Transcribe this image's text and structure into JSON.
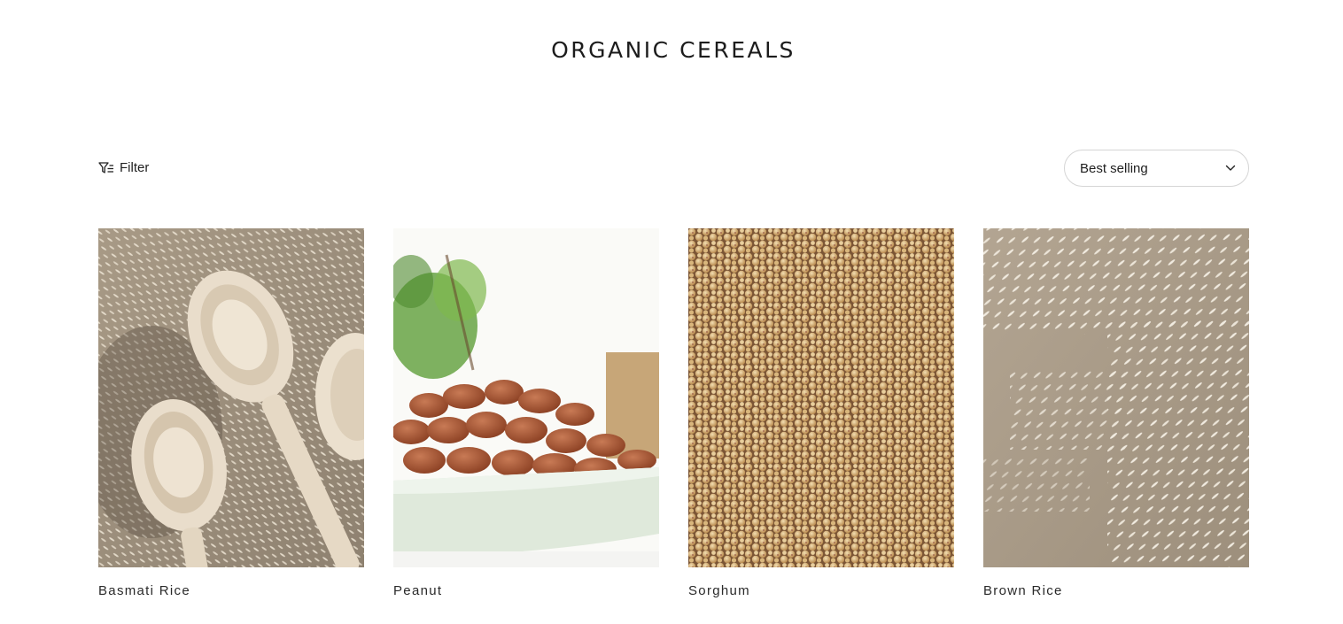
{
  "page": {
    "title": "ORGANIC CEREALS"
  },
  "toolbar": {
    "filter_label": "Filter",
    "filter_icon": "filter-icon",
    "sort_selected": "Best selling",
    "sort_icon": "chevron-down-icon"
  },
  "products": [
    {
      "name": "Basmati Rice",
      "image": "basmati-rice-spoons-photo"
    },
    {
      "name": "Peanut",
      "image": "peanuts-in-dish-photo"
    },
    {
      "name": "Sorghum",
      "image": "sorghum-grains-photo"
    },
    {
      "name": "Brown Rice",
      "image": "rice-grains-scattered-photo"
    }
  ]
}
